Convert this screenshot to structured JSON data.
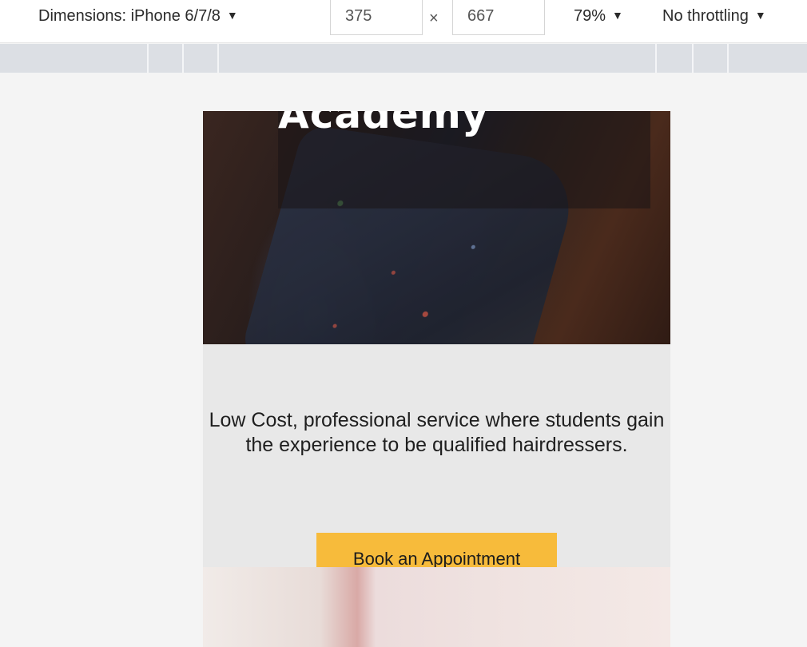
{
  "devtools": {
    "dimensions_label": "Dimensions: iPhone 6/7/8",
    "width_value": "375",
    "height_value": "667",
    "times_symbol": "×",
    "zoom_label": "79%",
    "throttling_label": "No throttling",
    "caret": "▼"
  },
  "page": {
    "hero_title": "Academy",
    "tagline": "Low Cost, professional service where students gain the experience to be qualified hairdressers.",
    "cta_label": "Book an Appointment"
  },
  "colors": {
    "cta_background": "#f7bb3b",
    "page_background": "#e8e8e8",
    "ruler": "#dcdfe4"
  }
}
